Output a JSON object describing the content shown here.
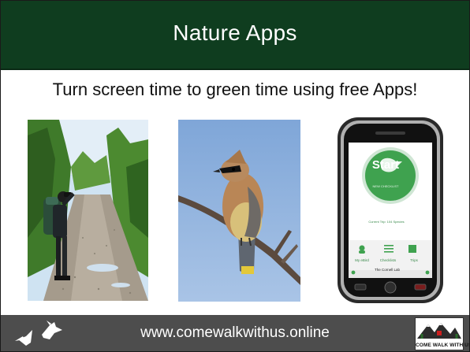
{
  "slide": {
    "title": "Nature Apps",
    "subtitle": "Turn screen time to green time using free Apps!"
  },
  "photos": [
    {
      "subject": "birdwatcher-with-binoculars-on-forest-trail"
    },
    {
      "subject": "cedar-waxwing-on-branch"
    },
    {
      "subject": "smartphone-with-birding-app"
    }
  ],
  "phone_app": {
    "start_label": "Start",
    "start_sub": "NEW CHECKLIST",
    "species_text": "Current Trip: 104 Species",
    "nav": [
      "My eBird",
      "Checklists",
      "Trips"
    ],
    "brand": "The Cornell Lab"
  },
  "footer": {
    "url": "www.comewalkwithus.online",
    "logo_text": "COME WALK WITH US"
  },
  "colors": {
    "header_bg": "#0f3d1f",
    "footer_bg": "#4d4d4d",
    "app_green": "#3fa24f"
  }
}
